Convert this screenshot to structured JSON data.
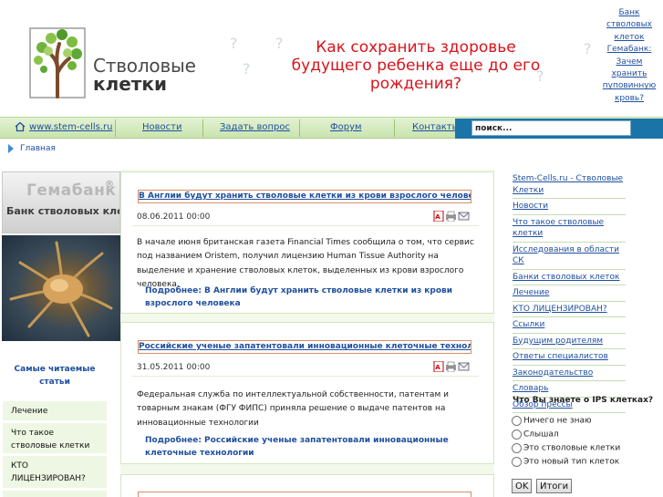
{
  "logo": {
    "line1": "Стволовые",
    "line2": "клетки"
  },
  "banner": {
    "line1": "Как сохранить здоровье",
    "line2": "будущего ребенка еще до его рождения?"
  },
  "header_links": {
    "lines": [
      "Банк",
      "стволовых",
      "клеток",
      "Гемабанк:",
      "Зачем",
      "хранить",
      "пуповинную",
      "кровь?"
    ]
  },
  "nav": {
    "home": "www.stem-cells.ru",
    "items": [
      "Новости",
      "Задать вопрос",
      "Форум",
      "Контакты"
    ]
  },
  "search": {
    "value": "поиск..."
  },
  "breadcrumb": {
    "label": "Главная"
  },
  "gemabank": {
    "title": "Гемабанк",
    "reg": "®",
    "subtitle": "Банк стволовых клеток"
  },
  "left": {
    "heading": "Самые читаемые статьи",
    "items": [
      "Лечение",
      "Что такое стволовые клетки",
      "КТО ЛИЦЕНЗИРОВАН?"
    ]
  },
  "articles": [
    {
      "title": "В Англии будут хранить стволовые клетки из крови взрослого человека",
      "date": "08.06.2011 00:00",
      "body": "В начале июня британская газета Financial Times сообщила о том, что сервис под названием Oristem, получил лицензию Human Tissue Authority на выделение и хранение стволовых клеток, выделенных из крови взрослого человека.",
      "more": "Подробнее: В Англии будут хранить стволовые клетки из крови взрослого человека"
    },
    {
      "title": "Российские ученые запатентовали инновационные клеточные технологии",
      "date": "31.05.2011 00:00",
      "body": "Федеральная служба по интеллектуальной собственности, патентам и товарным знакам (ФГУ ФИПС) приняла решение о выдаче патентов на инновационные технологии",
      "more": "Подробнее: Российские ученые запатентовали инновационные клеточные технологии"
    }
  ],
  "right_menu": {
    "items": [
      "Stem-Cells.ru - Стволовые Клетки",
      "Новости",
      "Что такое стволовые клетки",
      "Исследования в области СК",
      "Банки стволовых клеток",
      "Лечение",
      "КТО ЛИЦЕНЗИРОВАН?",
      "Ссылки",
      "Будущим родителям",
      "Ответы специалистов",
      "Законодательство",
      "Словарь",
      "Обзор прессы"
    ]
  },
  "poll": {
    "question": "Что Вы знаете о IPS клетках?",
    "options": [
      "Ничего не знаю",
      "Слышал",
      "Это стволовые клетки",
      "Это новый тип клеток"
    ],
    "ok_label": "OK",
    "results_label": "Итоги"
  },
  "colors": {
    "banner_red": "#d8141c",
    "link_blue": "#1f4f9e",
    "nav_green": "#c9e4ae",
    "search_blue": "#1a74a8"
  }
}
